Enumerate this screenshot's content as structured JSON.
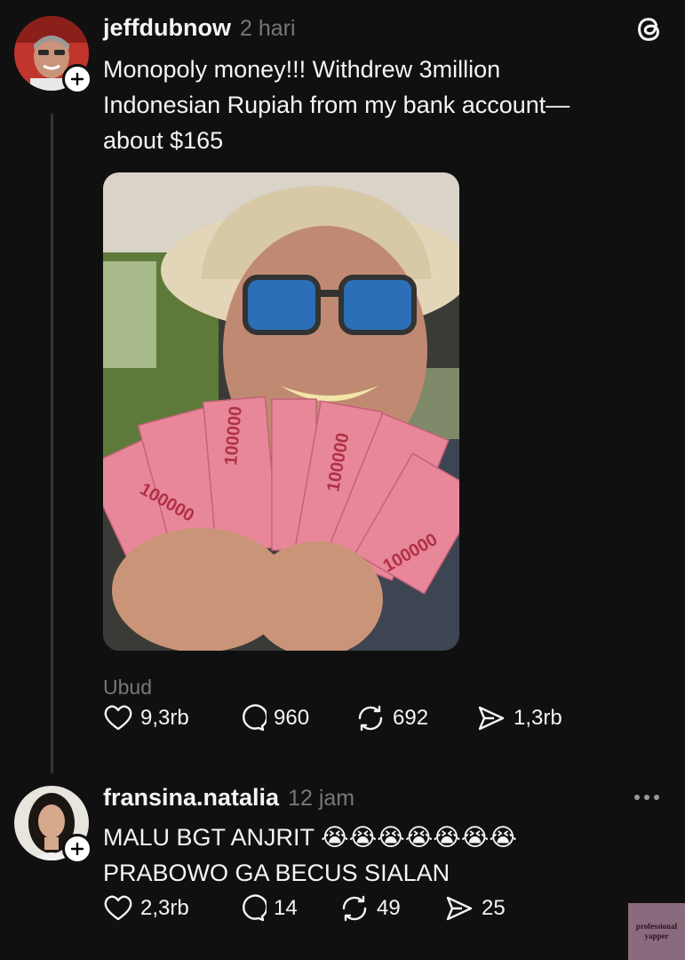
{
  "posts": [
    {
      "username": "jeffdubnow",
      "timestamp": "2 hari",
      "text": "Monopoly money!!! Withdrew 3million\nIndonesian Rupiah from my bank account—\nabout $165",
      "location": "Ubud",
      "likes": "9,3rb",
      "replies": "960",
      "reposts": "692",
      "shares": "1,3rb"
    },
    {
      "username": "fransina.natalia",
      "timestamp": "12 jam",
      "text": "MALU BGT ANJRIT 😭😭😭😭😭😭😭\nPRABOWO GA BECUS SIALAN",
      "likes": "2,3rb",
      "replies": "14",
      "reposts": "49",
      "shares": "25"
    }
  ],
  "banknote_value": "100000",
  "watermark": "professional yapper",
  "colors": {
    "background": "#101010",
    "text": "#f3f5f7",
    "muted": "#777777",
    "banknote": "#e8879a"
  },
  "icons": [
    "threads-logo-icon",
    "heart-icon",
    "reply-icon",
    "repost-icon",
    "share-icon",
    "more-icon",
    "plus-icon"
  ]
}
